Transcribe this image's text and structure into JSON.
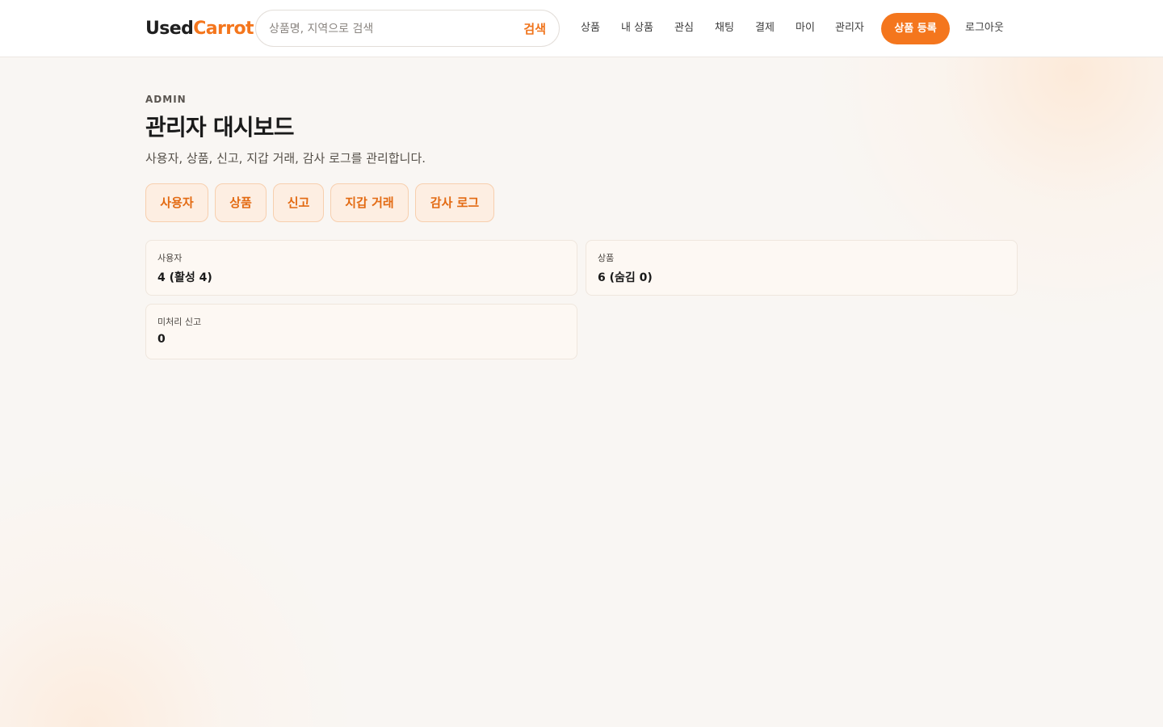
{
  "header": {
    "logo_part1": "Used",
    "logo_part2": "Carrot",
    "search_placeholder": "상품명, 지역으로 검색",
    "search_button": "검색",
    "nav": [
      "상품",
      "내 상품",
      "관심",
      "채팅",
      "결제",
      "마이",
      "관리자"
    ],
    "cta": "상품 등록",
    "logout": "로그아웃"
  },
  "colors": {
    "accent": "#f4761d",
    "background": "#f9f6f3",
    "tab_background": "#fdeee2"
  },
  "main": {
    "eyebrow": "ADMIN",
    "title": "관리자 대시보드",
    "subtitle": "사용자, 상품, 신고, 지갑 거래, 감사 로그를 관리합니다.",
    "tabs": [
      "사용자",
      "상품",
      "신고",
      "지갑 거래",
      "감사 로그"
    ],
    "stats": [
      {
        "label": "사용자",
        "value": "4 (활성 4)"
      },
      {
        "label": "상품",
        "value": "6 (숨김 0)"
      },
      {
        "label": "미처리 신고",
        "value": "0"
      }
    ]
  }
}
